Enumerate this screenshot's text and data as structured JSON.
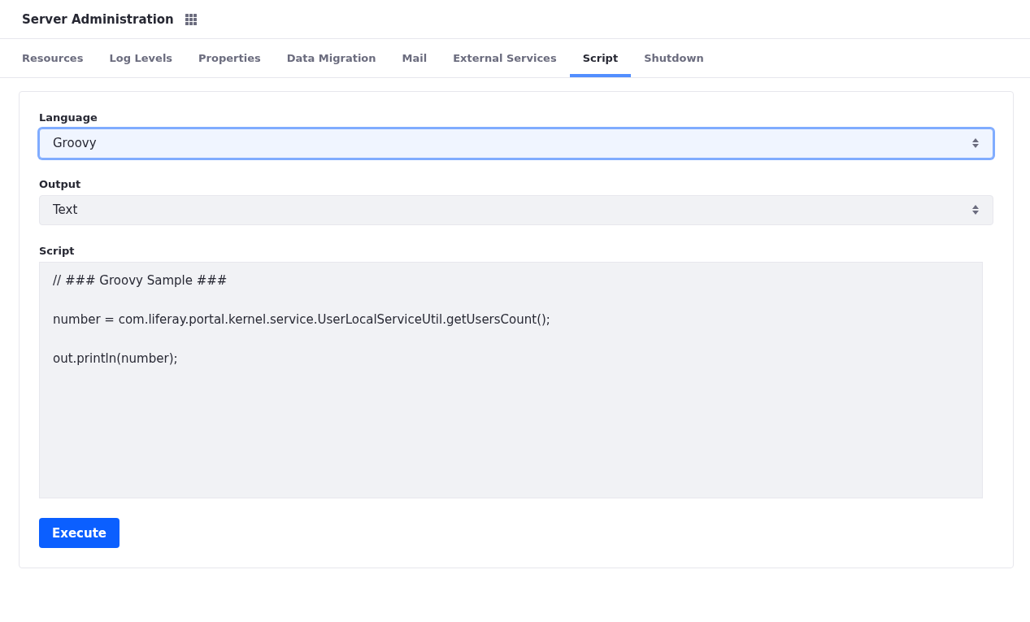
{
  "header": {
    "title": "Server Administration"
  },
  "tabs": [
    {
      "label": "Resources",
      "selected": false
    },
    {
      "label": "Log Levels",
      "selected": false
    },
    {
      "label": "Properties",
      "selected": false
    },
    {
      "label": "Data Migration",
      "selected": false
    },
    {
      "label": "Mail",
      "selected": false
    },
    {
      "label": "External Services",
      "selected": false
    },
    {
      "label": "Script",
      "selected": true
    },
    {
      "label": "Shutdown",
      "selected": false
    }
  ],
  "form": {
    "language": {
      "label": "Language",
      "value": "Groovy",
      "focused": true
    },
    "output": {
      "label": "Output",
      "value": "Text",
      "focused": false
    },
    "script": {
      "label": "Script",
      "value": "// ### Groovy Sample ###\n\nnumber = com.liferay.portal.kernel.service.UserLocalServiceUtil.getUsersCount();\n\nout.println(number);"
    },
    "button": "Execute"
  }
}
